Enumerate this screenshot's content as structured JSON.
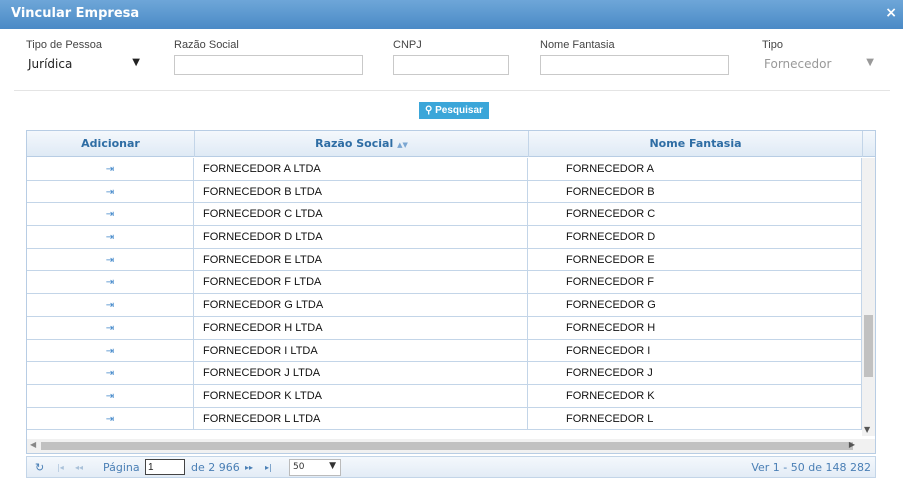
{
  "dialog": {
    "title": "Vincular Empresa",
    "close_glyph": "×"
  },
  "filters": {
    "tipo_pessoa": {
      "label": "Tipo de Pessoa",
      "value": "Jurídica"
    },
    "razao_social": {
      "label": "Razão Social",
      "value": ""
    },
    "cnpj": {
      "label": "CNPJ",
      "value": ""
    },
    "nome_fantasia": {
      "label": "Nome Fantasia",
      "value": ""
    },
    "tipo": {
      "label": "Tipo",
      "value": "Fornecedor"
    }
  },
  "search_button": {
    "label": "Pesquisar",
    "icon": "search-icon"
  },
  "grid": {
    "columns": [
      "Adicionar",
      "Razão Social",
      "Nome Fantasia"
    ],
    "sort_indicator": "▲▼",
    "add_glyph": "⇥",
    "rows": [
      {
        "razao_social": "FORNECEDOR A LTDA",
        "nome_fantasia": "FORNECEDOR A"
      },
      {
        "razao_social": "FORNECEDOR B LTDA",
        "nome_fantasia": "FORNECEDOR B"
      },
      {
        "razao_social": "FORNECEDOR C LTDA",
        "nome_fantasia": "FORNECEDOR C"
      },
      {
        "razao_social": "FORNECEDOR D LTDA",
        "nome_fantasia": "FORNECEDOR D"
      },
      {
        "razao_social": "FORNECEDOR E LTDA",
        "nome_fantasia": "FORNECEDOR E"
      },
      {
        "razao_social": "FORNECEDOR F LTDA",
        "nome_fantasia": "FORNECEDOR F"
      },
      {
        "razao_social": "FORNECEDOR G LTDA",
        "nome_fantasia": "FORNECEDOR G"
      },
      {
        "razao_social": "FORNECEDOR H LTDA",
        "nome_fantasia": "FORNECEDOR H"
      },
      {
        "razao_social": "FORNECEDOR I LTDA",
        "nome_fantasia": "FORNECEDOR I"
      },
      {
        "razao_social": "FORNECEDOR J LTDA",
        "nome_fantasia": "FORNECEDOR J"
      },
      {
        "razao_social": "FORNECEDOR K LTDA",
        "nome_fantasia": "FORNECEDOR K"
      },
      {
        "razao_social": "FORNECEDOR L LTDA",
        "nome_fantasia": "FORNECEDOR L"
      }
    ]
  },
  "pager": {
    "refresh_glyph": "↻",
    "first_glyph": "|◂",
    "prev_glyph": "◂◂",
    "page_label": "Página",
    "page_value": "1",
    "of_label": "de 2 966",
    "next_glyph": "▸▸",
    "last_glyph": "▸|",
    "rows_per_page": "50",
    "info": "Ver 1 - 50 de 148 282"
  }
}
